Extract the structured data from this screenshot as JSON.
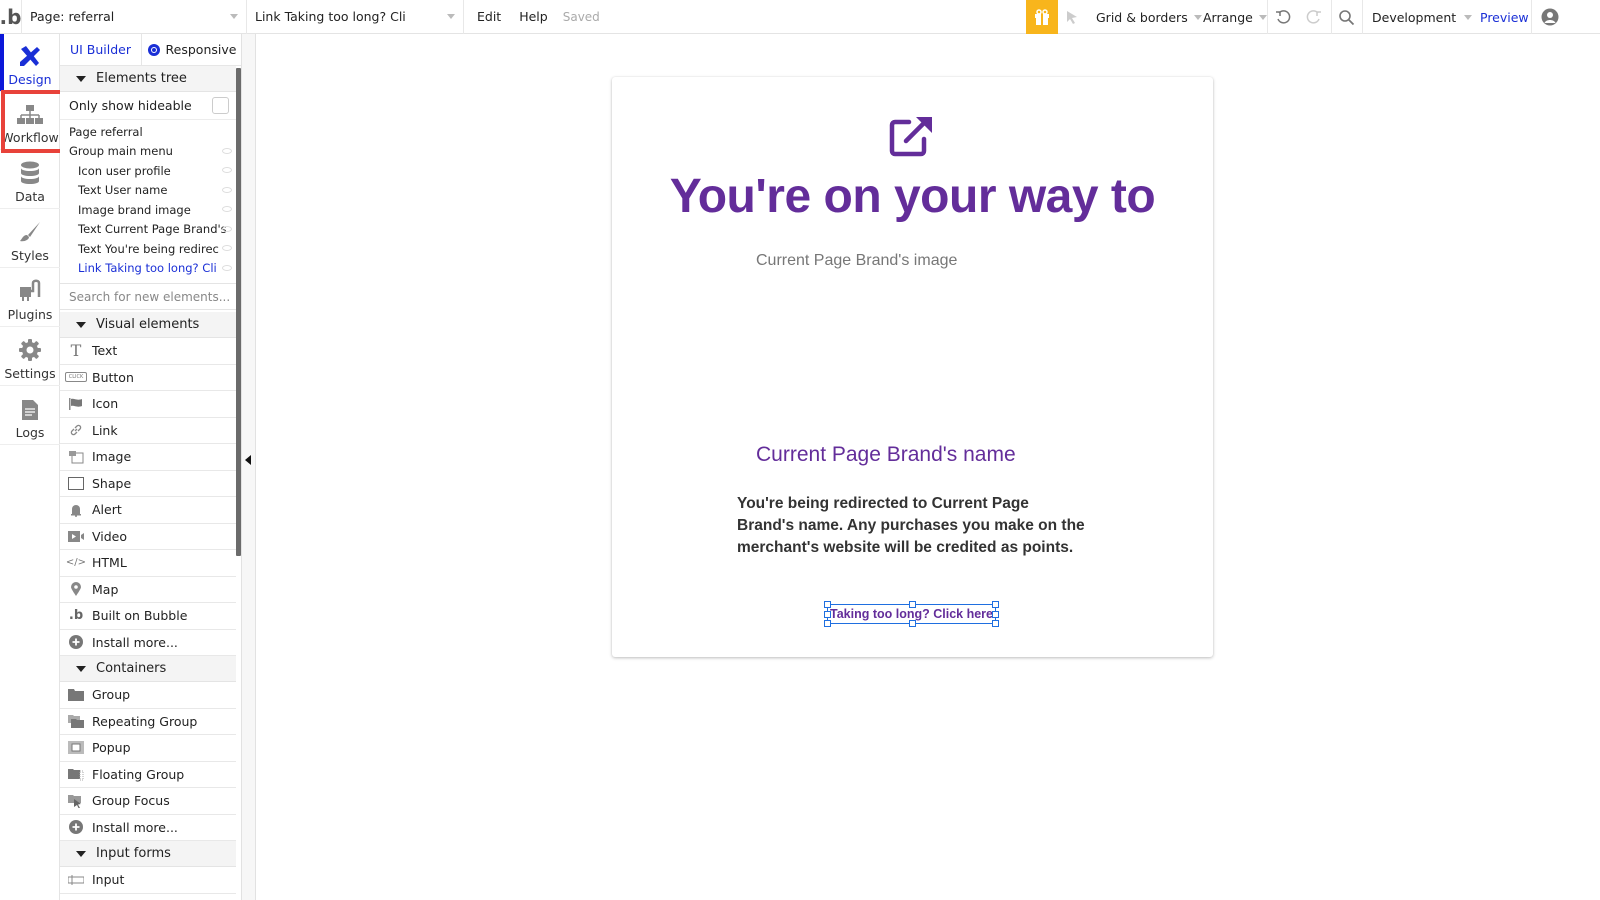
{
  "topbar": {
    "page_selector": "Page: referral",
    "element_selector": "Link Taking too long? Cli",
    "menu": [
      "Edit",
      "Help"
    ],
    "status": "Saved",
    "grid_borders": "Grid & borders",
    "arrange": "Arrange",
    "environment": "Development",
    "preview": "Preview"
  },
  "leftnav": {
    "items": [
      {
        "label": "Design",
        "icon": "design-icon",
        "active": true
      },
      {
        "label": "Workflow",
        "icon": "workflow-icon",
        "highlighted": true
      },
      {
        "label": "Data",
        "icon": "database-icon"
      },
      {
        "label": "Styles",
        "icon": "brush-icon"
      },
      {
        "label": "Plugins",
        "icon": "plug-icon"
      },
      {
        "label": "Settings",
        "icon": "gear-icon"
      },
      {
        "label": "Logs",
        "icon": "document-icon"
      }
    ],
    "highlight_color": "#e8423a",
    "accent_color": "#0b17d9"
  },
  "palette": {
    "tabs": [
      "UI Builder",
      "Responsive"
    ],
    "elements_tree": {
      "header": "Elements tree",
      "only_hideable_label": "Only show hideable",
      "items": [
        {
          "label": "Page referral",
          "indent": 0
        },
        {
          "label": "Group main menu",
          "indent": 0
        },
        {
          "label": "Icon user profile",
          "indent": 1
        },
        {
          "label": "Text User name",
          "indent": 1
        },
        {
          "label": "Image brand image",
          "indent": 1
        },
        {
          "label": "Text Current Page Brand's",
          "indent": 1
        },
        {
          "label": "Text You're being redirec",
          "indent": 1
        },
        {
          "label": "Link Taking too long? Cli",
          "indent": 1,
          "selected": true
        }
      ]
    },
    "search_placeholder": "Search for new elements...",
    "visual_elements": {
      "header": "Visual elements",
      "items": [
        "Text",
        "Button",
        "Icon",
        "Link",
        "Image",
        "Shape",
        "Alert",
        "Video",
        "HTML",
        "Map",
        "Built on Bubble",
        "Install more..."
      ]
    },
    "containers": {
      "header": "Containers",
      "items": [
        "Group",
        "Repeating Group",
        "Popup",
        "Floating Group",
        "Group Focus",
        "Install more..."
      ]
    },
    "input_forms": {
      "header": "Input forms",
      "items": [
        "Input"
      ]
    }
  },
  "canvas": {
    "headline": "You're on your way to",
    "brand_image_placeholder": "Current Page Brand's image",
    "brand_name": "Current Page Brand's name",
    "redirect_text": "You're being redirected to Current Page Brand's name. Any purchases you make on the merchant's website will be credited as points.",
    "link_text": "Taking too long? Click here",
    "brand_color": "#632d9a",
    "selection_color": "#1f6fe0"
  }
}
